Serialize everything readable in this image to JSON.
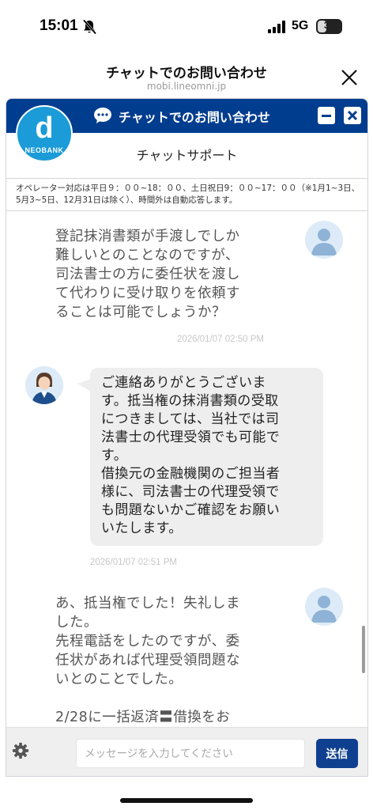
{
  "status_bar": {
    "time": "15:01",
    "network": "5G",
    "battery": "37",
    "battery_fraction": 0.37
  },
  "header": {
    "title": "チャットでのお問い合わせ",
    "url": "mobi.lineomni.jp",
    "close_icon": "close-x-icon"
  },
  "widget": {
    "title": "チャットでのお問い合わせ",
    "logo_letter": "d",
    "logo_text": "NEOBANK",
    "support_title": "チャットサポート",
    "notice": "オペレーター対応は平日９：００~18：００、土日祝日9：００~17：００（※1月1~3日、5月3~5日、12月31日は除く）、時間外は自動応答します。",
    "colors": {
      "titlebar": "#003d8f",
      "logo": "#1b9bd7",
      "send": "#0f3f8f"
    }
  },
  "messages": [
    {
      "sender": "user",
      "text": "登記抹消書類が手渡しでしか\n難しいとのことなのですが、\n司法書士の方に委任状を渡し\nて代わりに受け取りを依頼す\nることは可能でしょうか？",
      "time": "2026/01/07 02:50 PM"
    },
    {
      "sender": "operator",
      "text": "ご連絡ありがとうございま\nす。抵当権の抹消書類の受取\nにつきましては、当社では司\n法書士の代理受領でも可能で\nす。\n借換元の金融機関のご担当者\n様に、司法書士の代理受領で\nも問題ないかご確認をお願い\nいたします。",
      "time": "2026/01/07 02:51 PM"
    },
    {
      "sender": "user",
      "text": "あ、抵当権でした！失礼しま\nした。\n先程電話をしたのですが、委\n任状があれば代理受領問題な\nいとのことでした。\n\n2/28に一括返済〓借換をお"
    }
  ],
  "input": {
    "placeholder": "メッセージを入力してください",
    "value": "",
    "send_label": "送信"
  }
}
